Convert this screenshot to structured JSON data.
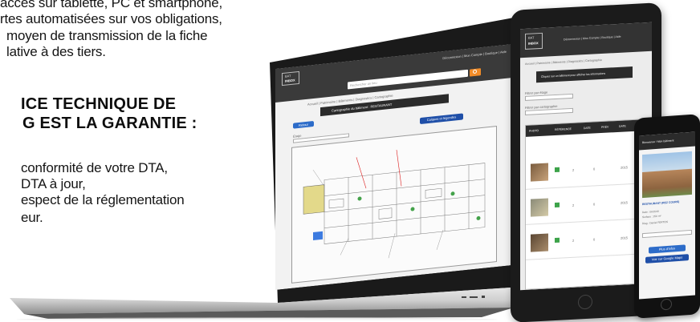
{
  "intro": {
    "lines": [
      "accès sur tablette, PC et smartphone,",
      "rtes automatisées sur vos obligations,",
      "moyen de transmission de la fiche",
      "lative à des tiers."
    ]
  },
  "guarantee": {
    "heading_lines": [
      "ICE TECHNIQUE DE",
      "G EST LA GARANTIE :"
    ],
    "items": [
      "conformité de votre DTA,",
      "DTA à jour,",
      "espect de la réglementation",
      "eur."
    ]
  },
  "laptop_app": {
    "logo_line1": "BAT",
    "logo_line2": "INBOX",
    "header_links": "Déconnexion | Mon Compte | Boutique | Aide",
    "search_placeholder": "Rechercher un lieu",
    "breadcrumb": "Accueil | Patrimoine | Bâtiments | Diagnostics | Cartographie",
    "page_title": "Cartographie du bâtiment : RESTAURANT",
    "back_button": "Retour",
    "level_label": "Étage",
    "export_button": "Calques et légendes"
  },
  "tablet_app": {
    "logo_line1": "BAT",
    "logo_line2": "INBOX",
    "header_links": "Déconnexion | Mon Compte | Boutique | Aide",
    "tabs": "Accueil | Patrimoine | Bâtiments | Diagnostics | Cartographie",
    "banner": "Cliquez sur un bâtiment pour afficher les informations",
    "filter_label_1": "Filtrer par étage",
    "filter_label_2": "Filtrer par cartographie",
    "table_headers": [
      "PHOTO",
      "RÉFÉRENCE",
      "DATE",
      "PRÉV",
      "DATE"
    ],
    "row_values": [
      "2",
      "2018",
      "0",
      "2",
      "2015"
    ]
  },
  "phone_app": {
    "banner": "Bienvenue ! Mon bâtiment",
    "building_name": "RESTAURANT (REZ COURS)",
    "detail_1": "Date : 06/2016",
    "detail_2": "Surface : 250 m²",
    "detail_3": "Diag : Daniel FERTOS",
    "button_1": "Plus d'infos",
    "button_2": "Voir sur Google Maps"
  },
  "colors": {
    "brand_dark": "#2b2b2b",
    "accent_orange": "#f28c28",
    "primary_blue": "#1f4fa8",
    "button_blue": "#2d6cc9",
    "highlight_red": "#d22",
    "plan_yellow": "#e3d98a",
    "plan_blue": "#3d7be0"
  }
}
